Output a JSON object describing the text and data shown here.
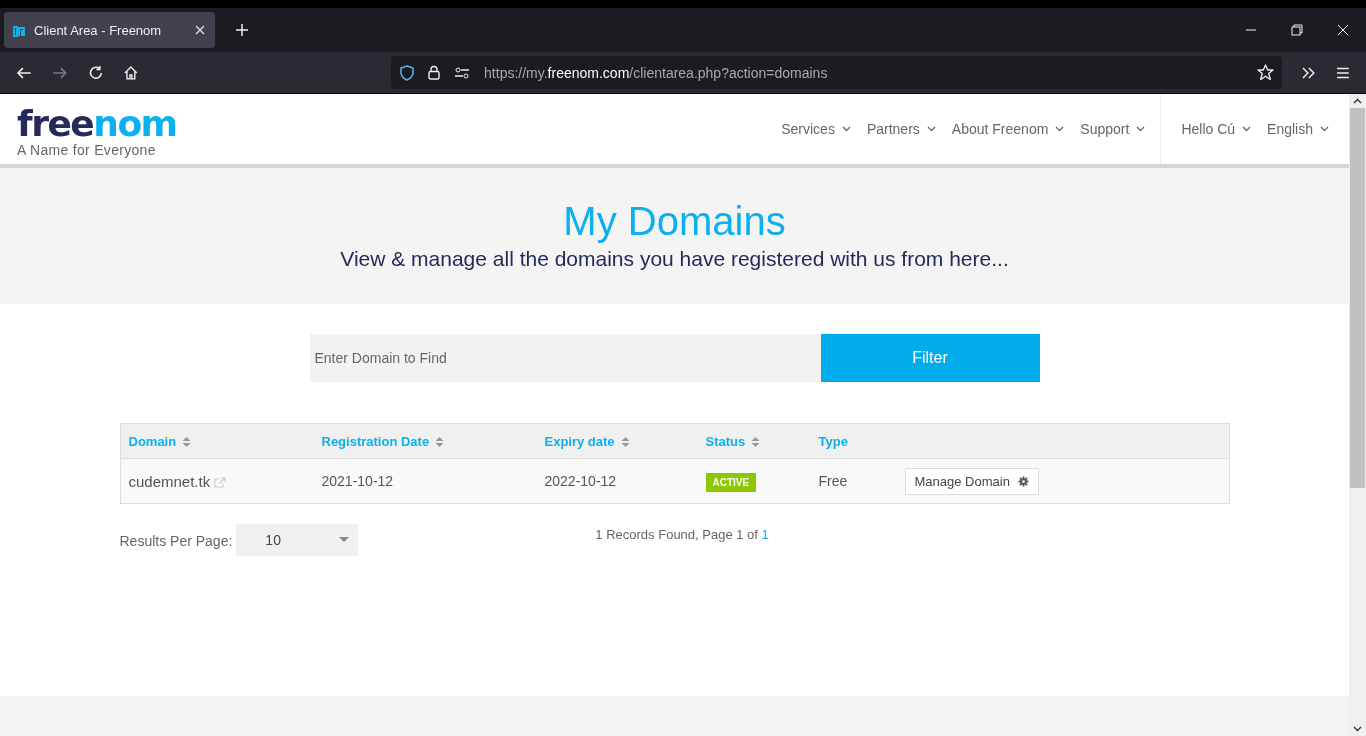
{
  "browser": {
    "tab": {
      "title": "Client Area - Freenom",
      "selected": true
    },
    "url": {
      "prefix": "https://my.",
      "host": "freenom.com",
      "suffix": "/clientarea.php?action=domains"
    },
    "forward_disabled": true
  },
  "header": {
    "logo": {
      "dark": "free",
      "accent": "nom"
    },
    "tagline": "A Name for Everyone",
    "nav": [
      "Services",
      "Partners",
      "About Freenom",
      "Support"
    ],
    "user_nav": [
      "Hello Cú",
      "English"
    ]
  },
  "hero": {
    "title": "My Domains",
    "subtitle": "View & manage all the domains you have registered with us from here..."
  },
  "search": {
    "placeholder": "Enter Domain to Find",
    "button": "Filter"
  },
  "table": {
    "columns": [
      {
        "label": "Domain",
        "sortable": true
      },
      {
        "label": "Registration Date",
        "sortable": true
      },
      {
        "label": "Expiry date",
        "sortable": true
      },
      {
        "label": "Status",
        "sortable": true
      },
      {
        "label": "Type",
        "sortable": false
      }
    ],
    "rows": [
      {
        "domain": "cudemnet.tk",
        "registration_date": "2021-10-12",
        "expiry_date": "2022-10-12",
        "status": "ACTIVE",
        "type": "Free",
        "action": "Manage Domain"
      }
    ]
  },
  "footer": {
    "results_label": "Results Per Page:",
    "per_page": "10",
    "records_text": "1 Records Found, Page 1 of ",
    "page_link": "1"
  }
}
